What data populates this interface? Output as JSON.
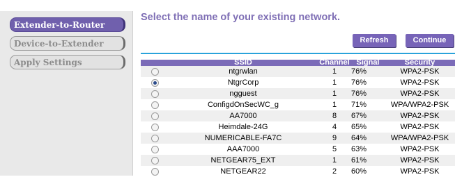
{
  "sidebar": {
    "items": [
      {
        "label": "Extender-to-Router",
        "active": true
      },
      {
        "label": "Device-to-Extender",
        "active": false
      },
      {
        "label": "Apply Settings",
        "active": false
      }
    ]
  },
  "main": {
    "heading": "Select the name of your existing network.",
    "refresh_label": "Refresh",
    "continue_label": "Continue"
  },
  "table": {
    "headers": {
      "ssid": "SSID",
      "channel": "Channel",
      "signal": "Signal",
      "security": "Security"
    },
    "rows": [
      {
        "selected": false,
        "ssid": "ntgrwlan",
        "channel": "1",
        "signal": "76%",
        "security": "WPA2-PSK"
      },
      {
        "selected": true,
        "ssid": "NtgrCorp",
        "channel": "1",
        "signal": "76%",
        "security": "WPA2-PSK"
      },
      {
        "selected": false,
        "ssid": "ngguest",
        "channel": "1",
        "signal": "76%",
        "security": "WPA2-PSK"
      },
      {
        "selected": false,
        "ssid": "ConfigdOnSecWC_g",
        "channel": "1",
        "signal": "71%",
        "security": "WPA/WPA2-PSK"
      },
      {
        "selected": false,
        "ssid": "AA7000",
        "channel": "8",
        "signal": "67%",
        "security": "WPA2-PSK"
      },
      {
        "selected": false,
        "ssid": "Heimdale-24G",
        "channel": "4",
        "signal": "65%",
        "security": "WPA2-PSK"
      },
      {
        "selected": false,
        "ssid": "NUMERICABLE-FA7C",
        "channel": "9",
        "signal": "64%",
        "security": "WPA/WPA2-PSK"
      },
      {
        "selected": false,
        "ssid": "AAA7000",
        "channel": "5",
        "signal": "63%",
        "security": "WPA2-PSK"
      },
      {
        "selected": false,
        "ssid": "NETGEAR75_EXT",
        "channel": "1",
        "signal": "61%",
        "security": "WPA2-PSK"
      },
      {
        "selected": false,
        "ssid": "NETGEAR22",
        "channel": "2",
        "signal": "60%",
        "security": "WPA2-PSK"
      }
    ]
  }
}
